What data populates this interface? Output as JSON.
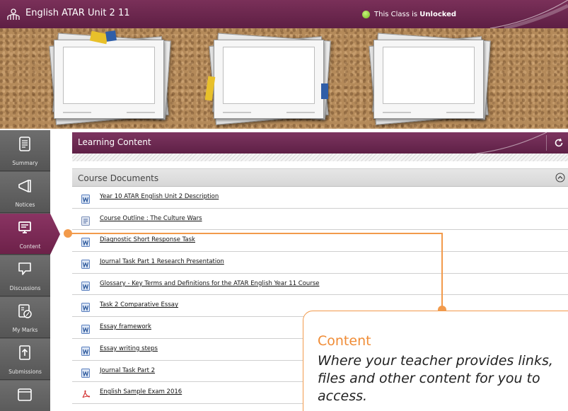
{
  "header": {
    "title": "English ATAR Unit 2 11",
    "status_prefix": "This Class is",
    "status_value": "Unlocked",
    "status_color": "#8bc34a",
    "brand_color": "#6b2750"
  },
  "banner": {
    "photo_frames": 3
  },
  "sidebar": {
    "items": [
      {
        "label": "Summary",
        "icon": "document-icon"
      },
      {
        "label": "Notices",
        "icon": "megaphone-icon"
      },
      {
        "label": "Content",
        "icon": "monitor-icon",
        "active": true
      },
      {
        "label": "Discussions",
        "icon": "chat-bubble-icon"
      },
      {
        "label": "My Marks",
        "icon": "marks-percent-icon"
      },
      {
        "label": "Submissions",
        "icon": "upload-icon"
      },
      {
        "label": "",
        "icon": "window-icon"
      }
    ]
  },
  "main": {
    "section_title": "Learning Content",
    "folder_title": "Course Documents",
    "documents": [
      {
        "title": "Year 10 ATAR English Unit 2 Description",
        "type": "word"
      },
      {
        "title": "Course Outline : The Culture Wars",
        "type": "word-generic"
      },
      {
        "title": "Diagnostic Short Response Task",
        "type": "word"
      },
      {
        "title": "Journal Task Part 1 Research Presentation",
        "type": "word"
      },
      {
        "title": "Glossary - Key Terms and Definitions for the ATAR English Year 11 Course",
        "type": "word"
      },
      {
        "title": "Task 2 Comparative Essay",
        "type": "word"
      },
      {
        "title": "Essay framework",
        "type": "word"
      },
      {
        "title": "Essay writing steps",
        "type": "word"
      },
      {
        "title": "Journal Task Part 2",
        "type": "word"
      },
      {
        "title": "English Sample Exam 2016",
        "type": "pdf"
      }
    ]
  },
  "callout": {
    "title": "Content",
    "description": "Where your teacher provides links, files and other content for you to access.",
    "accent_color": "#f29a4b"
  }
}
